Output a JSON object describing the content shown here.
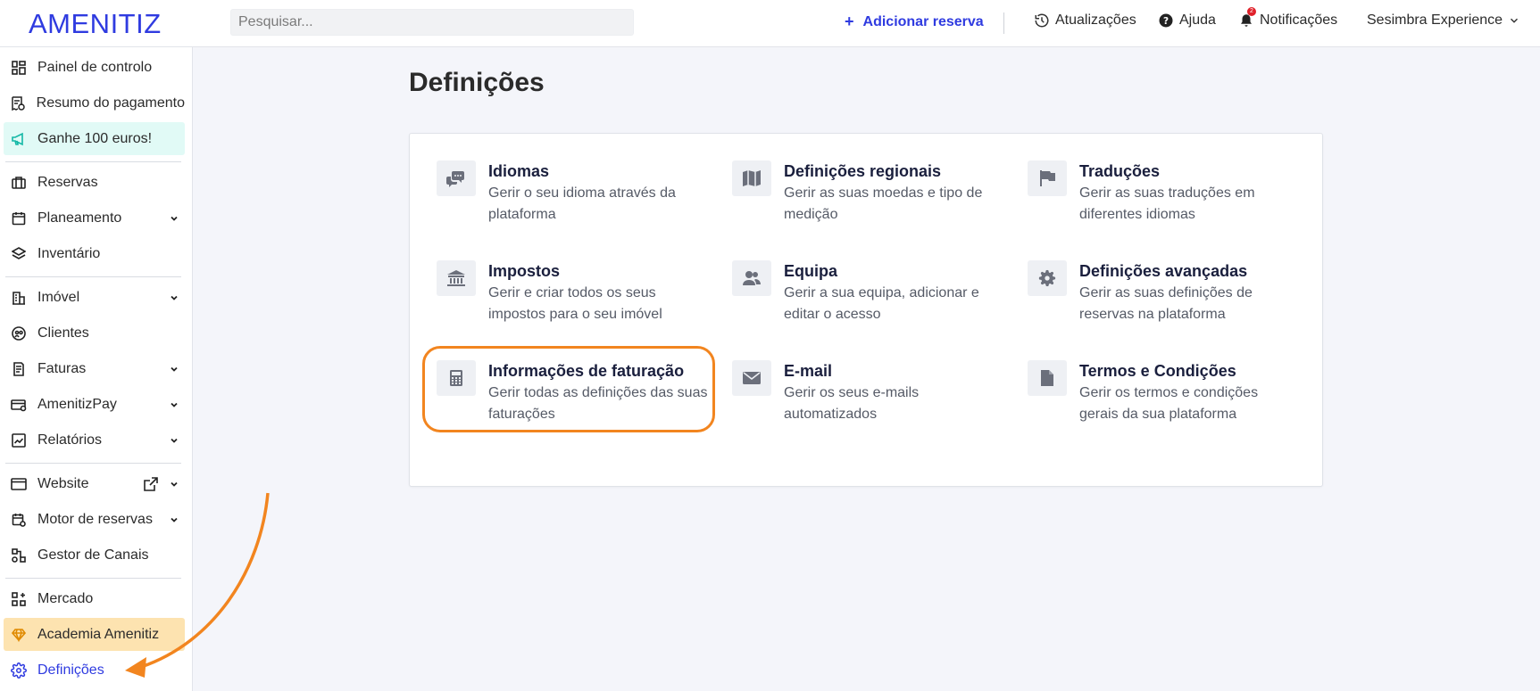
{
  "topbar": {
    "logo": "AMENITIZ",
    "search_placeholder": "Pesquisar...",
    "add_reservation": "Adicionar reserva",
    "updates": "Atualizações",
    "help": "Ajuda",
    "notifications": "Notificações",
    "notifications_count": "2",
    "account": "Sesimbra Experience"
  },
  "sidebar": {
    "items": [
      {
        "label": "Painel de controlo",
        "icon": "dashboard-icon"
      },
      {
        "label": "Resumo do pagamento",
        "icon": "receipt-euro-icon"
      },
      {
        "label": "Ganhe 100 euros!",
        "icon": "megaphone-icon"
      },
      {
        "label": "Reservas",
        "icon": "suitcase-icon"
      },
      {
        "label": "Planeamento",
        "icon": "calendar-icon"
      },
      {
        "label": "Inventário",
        "icon": "layers-icon"
      },
      {
        "label": "Imóvel",
        "icon": "building-icon"
      },
      {
        "label": "Clientes",
        "icon": "clients-icon"
      },
      {
        "label": "Faturas",
        "icon": "invoice-icon"
      },
      {
        "label": "AmenitizPay",
        "icon": "card-icon"
      },
      {
        "label": "Relatórios",
        "icon": "chart-icon"
      },
      {
        "label": "Website",
        "icon": "browser-icon"
      },
      {
        "label": "Motor de reservas",
        "icon": "booking-engine-icon"
      },
      {
        "label": "Gestor de Canais",
        "icon": "channels-icon"
      },
      {
        "label": "Mercado",
        "icon": "market-icon"
      },
      {
        "label": "Academia Amenitiz",
        "icon": "diamond-icon"
      },
      {
        "label": "Definições",
        "icon": "gear-icon"
      }
    ]
  },
  "main": {
    "title": "Definições",
    "settings": [
      {
        "title": "Idiomas",
        "desc1": "Gerir o seu idioma através da",
        "desc2": "plataforma",
        "icon": "chat-bubbles-icon"
      },
      {
        "title": "Definições regionais",
        "desc1": "Gerir as suas moedas e tipo de",
        "desc2": "medição",
        "icon": "map-icon"
      },
      {
        "title": "Traduções",
        "desc1": "Gerir as suas traduções em",
        "desc2": "diferentes idiomas",
        "icon": "flag-icon"
      },
      {
        "title": "Impostos",
        "desc1": "Gerir e criar todos os seus",
        "desc2": "impostos para o seu imóvel",
        "icon": "bank-icon"
      },
      {
        "title": "Equipa",
        "desc1": "Gerir a sua equipa, adicionar e",
        "desc2": "editar o acesso",
        "icon": "team-icon"
      },
      {
        "title": "Definições avançadas",
        "desc1": "Gerir as suas definições de",
        "desc2": "reservas na plataforma",
        "icon": "gear-icon"
      },
      {
        "title": "Informações de faturação",
        "desc1": "Gerir todas as definições das suas",
        "desc2": "faturações",
        "icon": "calculator-icon"
      },
      {
        "title": "E-mail",
        "desc1": "Gerir os seus e-mails",
        "desc2": "automatizados",
        "icon": "envelope-icon"
      },
      {
        "title": "Termos e Condições",
        "desc1": "Gerir os termos e condições",
        "desc2": "gerais da sua plataforma",
        "icon": "document-icon"
      }
    ]
  },
  "colors": {
    "brand": "#2f3be0",
    "highlight": "#f2851f",
    "promo_bg": "#e1faf6",
    "academy_bg": "#fde3b0"
  }
}
